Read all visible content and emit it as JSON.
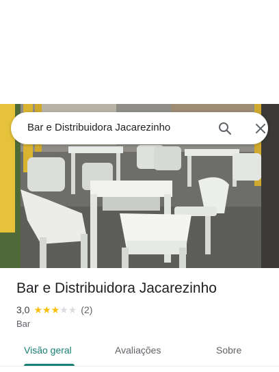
{
  "search": {
    "query": "Bar e Distribuidora Jacarezinho",
    "search_icon": "search-icon",
    "close_icon": "close-icon"
  },
  "place": {
    "name": "Bar e Distribuidora Jacarezinho",
    "rating": "3,0",
    "stars_filled": 3,
    "stars_total": 5,
    "review_count": "(2)",
    "category": "Bar",
    "photo": "white plastic tables and chairs on a patio"
  },
  "tabs": [
    {
      "label": "Visão geral",
      "active": true
    },
    {
      "label": "Avaliações",
      "active": false
    },
    {
      "label": "Sobre",
      "active": false
    }
  ],
  "colors": {
    "accent": "#1a7f73",
    "star": "#fbbc04",
    "star_empty": "#dadce0"
  }
}
